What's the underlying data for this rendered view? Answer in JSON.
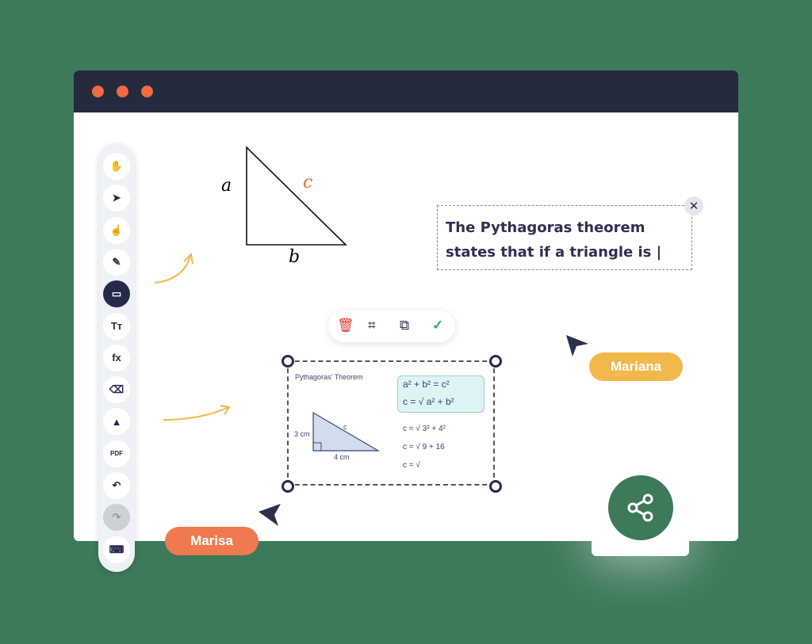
{
  "window": {
    "dots": [
      "#ef6a45",
      "#ef6a45",
      "#ef6a45"
    ]
  },
  "toolbar": {
    "tools": [
      {
        "name": "hand-icon",
        "glyph": "✋"
      },
      {
        "name": "select-arrow-icon",
        "glyph": "➤"
      },
      {
        "name": "pointer-hand-icon",
        "glyph": "☝"
      },
      {
        "name": "pencil-icon",
        "glyph": "✎"
      },
      {
        "name": "rectangle-icon",
        "glyph": "▭",
        "active": true
      },
      {
        "name": "text-icon",
        "glyph": "Tт"
      },
      {
        "name": "formula-icon",
        "glyph": "fx"
      },
      {
        "name": "eraser-icon",
        "glyph": "⌫"
      },
      {
        "name": "image-icon",
        "glyph": "▲"
      },
      {
        "name": "pdf-icon",
        "glyph": "PDF"
      },
      {
        "name": "undo-icon",
        "glyph": "↶"
      },
      {
        "name": "redo-icon",
        "glyph": "↷",
        "disabled": true
      },
      {
        "name": "keyboard-icon",
        "glyph": "⌨"
      }
    ]
  },
  "drawing": {
    "label_a": "a",
    "label_b": "b",
    "label_c": "c"
  },
  "textbox": {
    "text": "The Pythagoras theorem states that if a triangle is |"
  },
  "image_toolbar": {
    "delete": "🗑",
    "crop": "⌗",
    "copy": "⧉",
    "confirm": "✓"
  },
  "image": {
    "title": "Pythagoras' Theorem",
    "side_a": "3 cm",
    "side_b": "4 cm",
    "hyp": "c",
    "eq1": "a² + b² = c²",
    "eq2": "c = √ a² + b²",
    "step1": "c = √ 3² + 4²",
    "step2": "c = √ 9 + 16",
    "step3": "c = √"
  },
  "users": [
    {
      "name": "Mariana",
      "color": "#f2b84b"
    },
    {
      "name": "Marisa",
      "color": "#ef7a4f"
    }
  ],
  "share": {
    "icon": "share-icon",
    "color": "#3d7a5a"
  }
}
